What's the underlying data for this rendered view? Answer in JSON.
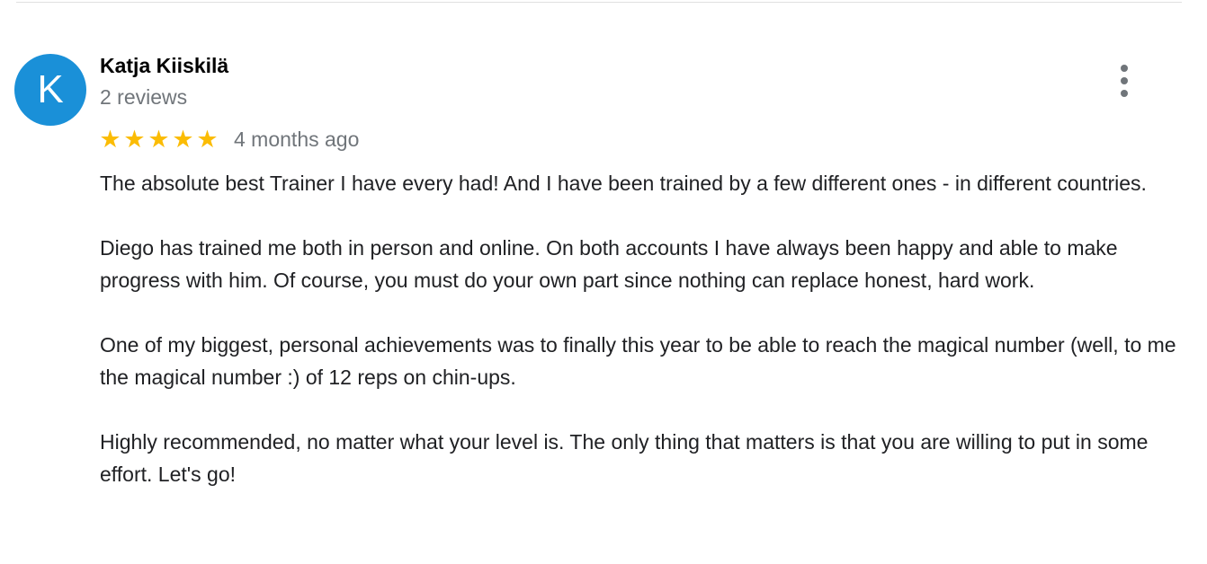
{
  "review": {
    "author": {
      "initial": "K",
      "name": "Katja Kiiskilä",
      "reviews_count": "2 reviews",
      "avatar_color": "#1a90d8"
    },
    "rating": {
      "stars": 5,
      "max": 5,
      "star_glyph": "★",
      "star_color": "#fbbc04"
    },
    "date": "4 months ago",
    "more_icon": "more-vert-icon",
    "paragraphs": [
      "The absolute best Trainer I have every had! And I have been trained by a few different ones - in different countries.",
      "Diego has trained me both in person and online. On both accounts I have always been happy and able to make progress with him. Of course, you must do your own part since nothing can replace honest, hard work.",
      "One of my biggest, personal achievements was to finally this year to be able to reach the magical number (well, to me the magical number :) of 12 reps on chin-ups.",
      "Highly recommended, no matter what your level is. The only thing that matters is that you are willing to put in some effort. Let's go!"
    ]
  }
}
